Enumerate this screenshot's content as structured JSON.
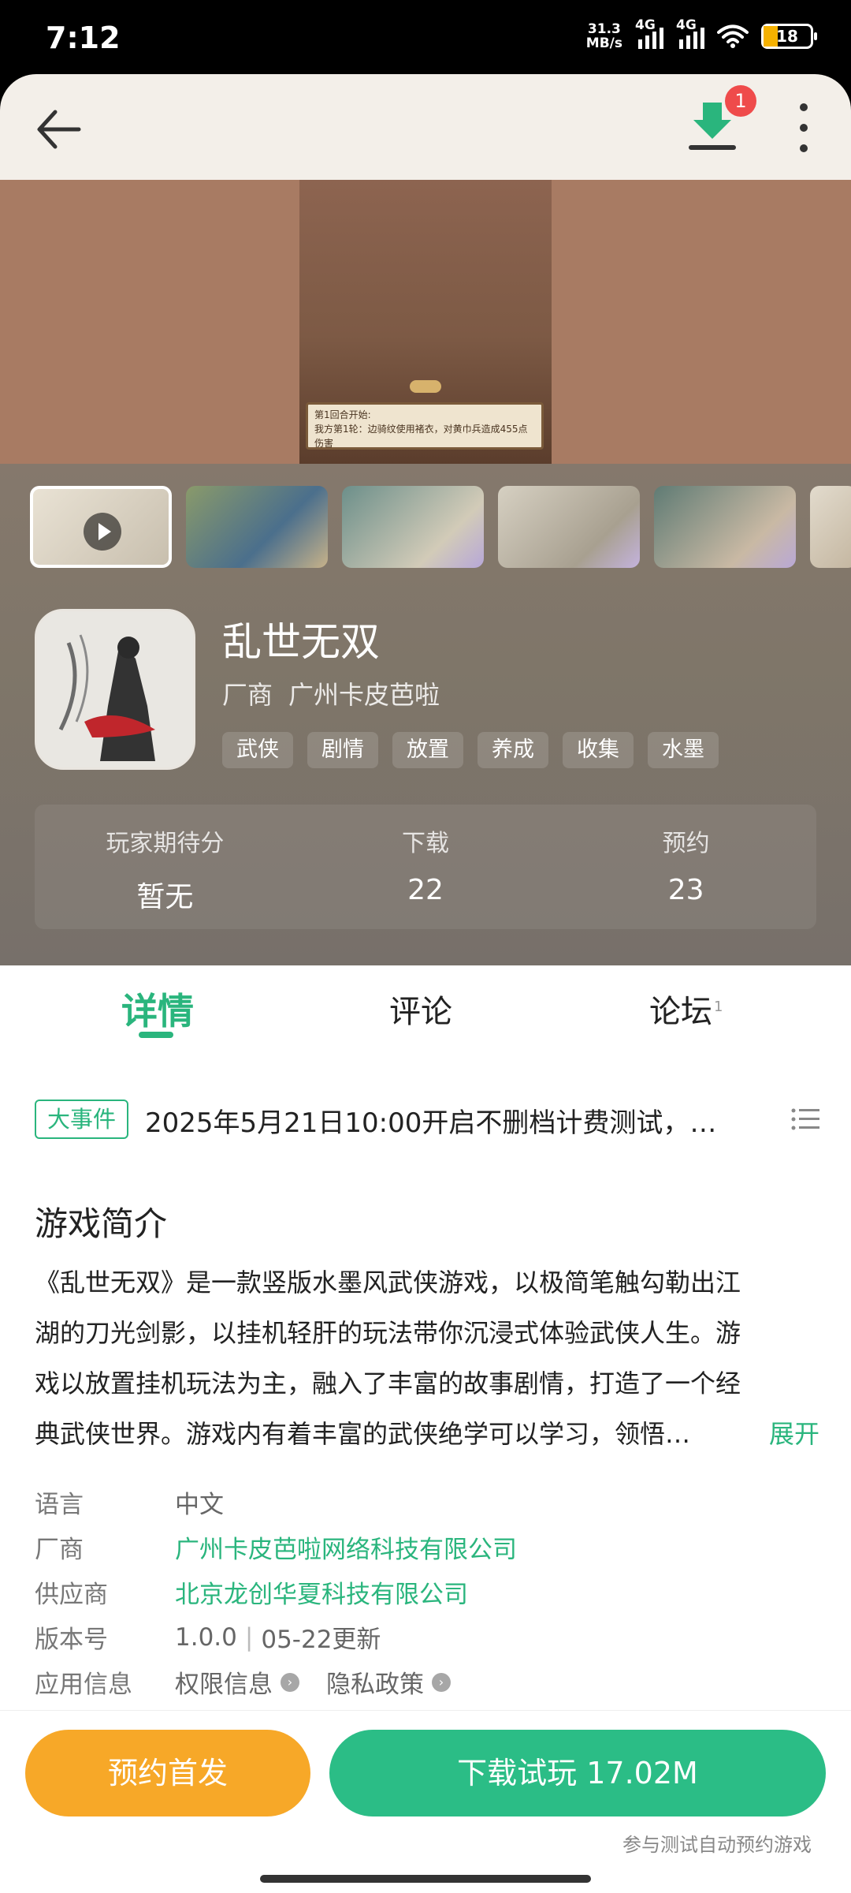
{
  "status": {
    "time": "7:12",
    "net_speed_top": "31.3",
    "net_speed_unit": "MB/s",
    "sig1": "4G",
    "sig2": "4G",
    "battery": "18"
  },
  "header": {
    "download_badge": "1"
  },
  "media": {
    "dialog_line1": "第1回合开始:",
    "dialog_line2": "我方第1轮：边骑纹使用褚衣，对黄巾兵造成455点伤害"
  },
  "app": {
    "title": "乱世无双",
    "developer_label": "厂商",
    "developer_name": "广州卡皮芭啦",
    "tags": [
      "武侠",
      "剧情",
      "放置",
      "养成",
      "收集",
      "水墨"
    ]
  },
  "stats": [
    {
      "label": "玩家期待分",
      "value": "暂无"
    },
    {
      "label": "下载",
      "value": "22"
    },
    {
      "label": "预约",
      "value": "23"
    }
  ],
  "tabs": {
    "detail": "详情",
    "comment": "评论",
    "forum": "论坛",
    "forum_count": "1"
  },
  "event": {
    "badge": "大事件",
    "text": "2025年5月21日10:00开启不删档计费测试，…"
  },
  "intro": {
    "title": "游戏简介",
    "lines": [
      "《乱世无双》是一款竖版水墨风武侠游戏，以极简笔触勾勒出江",
      "湖的刀光剑影，以挂机轻肝的玩法带你沉浸式体验武侠人生。游",
      "戏以放置挂机玩法为主，融入了丰富的故事剧情，打造了一个经",
      "典武侠世界。游戏内有着丰富的武侠绝学可以学习，领悟…"
    ],
    "expand": "展开"
  },
  "meta": {
    "language_label": "语言",
    "language": "中文",
    "vendor_label": "厂商",
    "vendor": "广州卡皮芭啦网络科技有限公司",
    "supplier_label": "供应商",
    "supplier": "北京龙创华夏科技有限公司",
    "version_label": "版本号",
    "version": "1.0.0",
    "update": "05-22更新",
    "appinfo_label": "应用信息",
    "permissions": "权限信息",
    "privacy": "隐私政策"
  },
  "bottom": {
    "reserve": "预约首发",
    "download": "下载试玩 17.02M",
    "note": "参与测试自动预约游戏"
  },
  "colors": {
    "accent": "#2ab57d",
    "reserve": "#f7a828",
    "download": "#2bbd86",
    "badge": "#ef4b4b"
  }
}
